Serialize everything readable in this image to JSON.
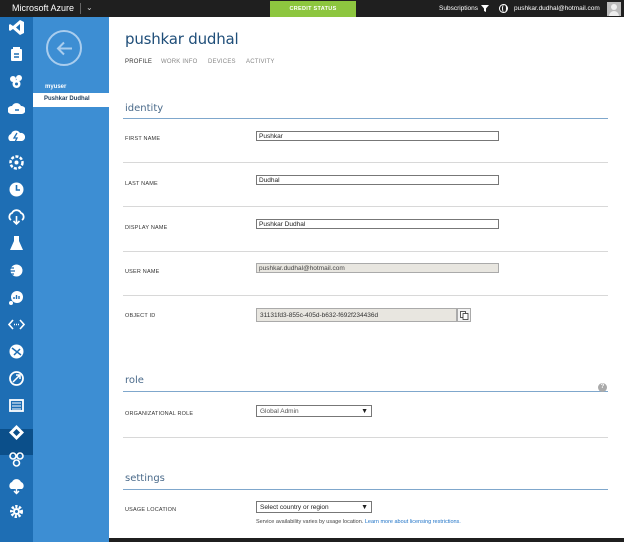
{
  "topbar": {
    "brand": "Microsoft Azure",
    "brand_chevron": "chevron-down-icon",
    "credit_status": "CREDIT STATUS",
    "subscriptions": "Subscriptions",
    "email": "pushkar.dudhal@hotmail.com",
    "colors": {
      "bar": "#1f1f1f",
      "credit": "#8dc63f"
    }
  },
  "nav": {
    "icons": [
      "visual-studio-icon",
      "mobile-services-icon",
      "cloud-services-icon",
      "cloud-services-icon",
      "batch-icon",
      "hdinsight-icon",
      "scheduler-icon",
      "recovery-services-icon",
      "machine-learning-icon",
      "stream-analytics-icon",
      "operational-insights-icon",
      "api-management-icon",
      "networks-icon",
      "traffic-manager-icon",
      "management-portal-icon",
      "active-directory-icon",
      "marketplace-icon",
      "cloud-upload-icon",
      "settings-icon"
    ],
    "colors": {
      "iconbar": "#1e6eb4",
      "sublist": "#3d8ed3"
    }
  },
  "sublist": {
    "section": "myuser",
    "active_item": "Pushkar Dudhal"
  },
  "page": {
    "title": "pushkar dudhal",
    "tabs": [
      "PROFILE",
      "WORK INFO",
      "DEVICES",
      "ACTIVITY"
    ]
  },
  "identity": {
    "heading": "identity",
    "first_name_label": "FIRST NAME",
    "first_name": "Pushkar",
    "last_name_label": "LAST NAME",
    "last_name": "Dudhal",
    "display_name_label": "DISPLAY NAME",
    "display_name": "Pushkar Dudhal",
    "user_name_label": "USER NAME",
    "user_name": "pushkar.dudhal@hotmail.com",
    "object_id_label": "OBJECT ID",
    "object_id": "31131fd3-855c-405d-b632-f692f234436d"
  },
  "role": {
    "heading": "role",
    "org_role_label": "ORGANIZATIONAL ROLE",
    "org_role": "Global Admin"
  },
  "settings": {
    "heading": "settings",
    "usage_location_label": "USAGE LOCATION",
    "usage_location": "Select country or region",
    "note": "Service availability varies by usage location.",
    "note_link": "Learn more about licensing restrictions."
  }
}
